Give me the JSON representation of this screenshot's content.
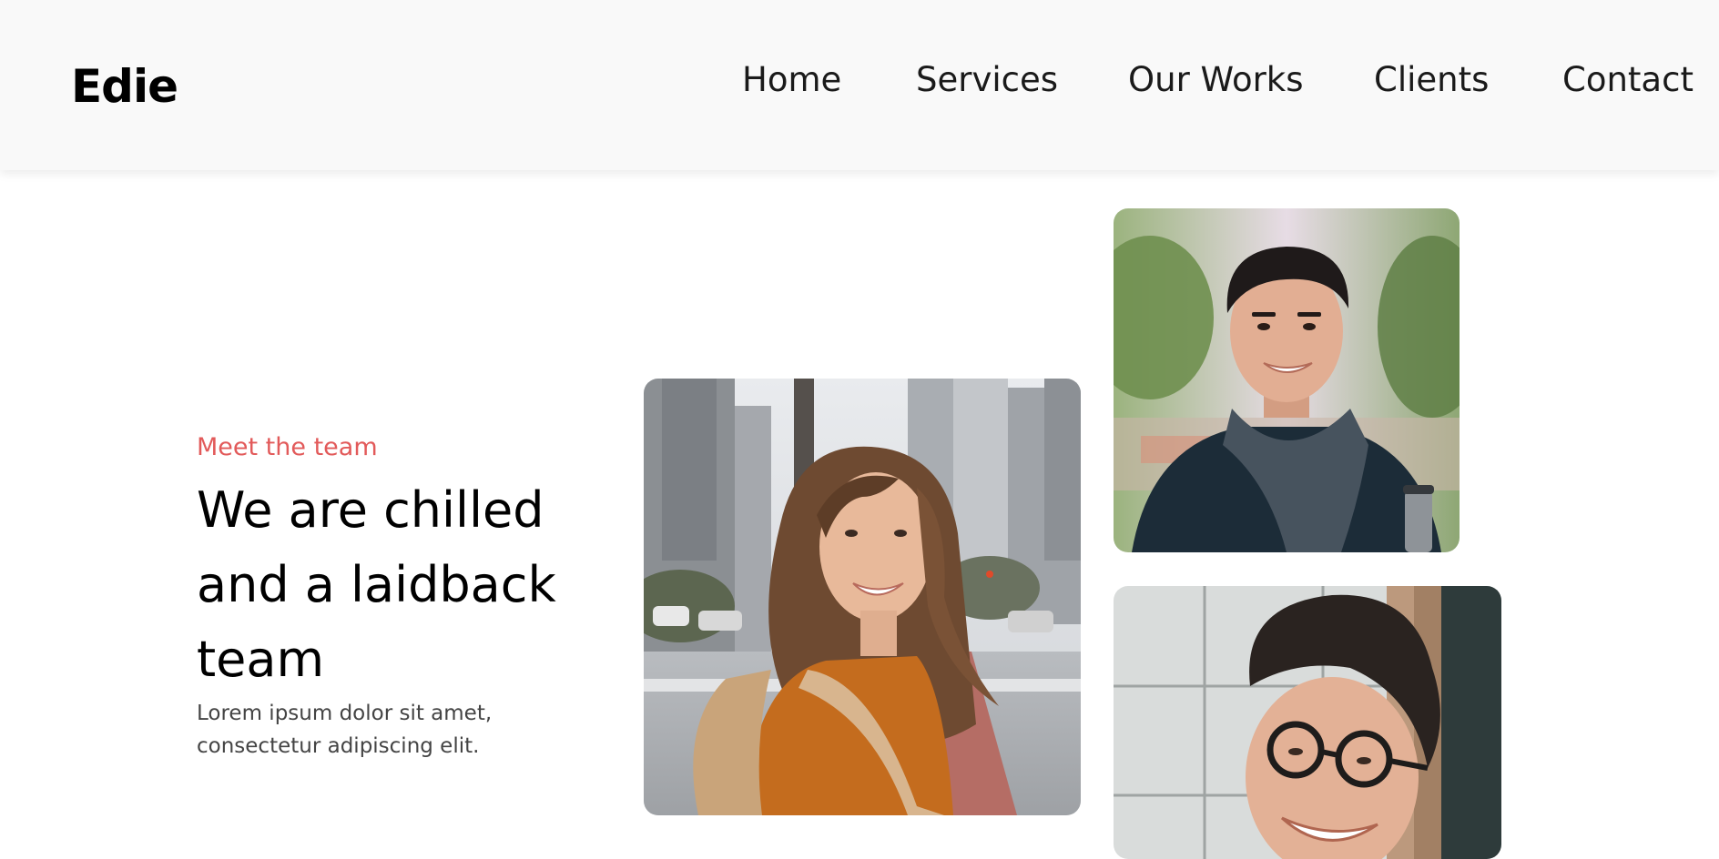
{
  "brand": {
    "name": "Edie"
  },
  "nav": {
    "items": [
      {
        "label": "Home"
      },
      {
        "label": "Services"
      },
      {
        "label": "Our Works"
      },
      {
        "label": "Clients"
      },
      {
        "label": "Contact"
      }
    ]
  },
  "hero": {
    "eyebrow": "Meet the team",
    "headline": "We are chilled and a laidback team",
    "lead": "Lorem ipsum dolor sit amet, consectetur adipiscing elit."
  },
  "colors": {
    "accent": "#e25a5a",
    "header_bg": "#f9f9f9",
    "text": "#000000"
  },
  "team_photos": [
    {
      "subject": "woman-smiling-city-street"
    },
    {
      "subject": "man-smiling-scarf"
    },
    {
      "subject": "man-smiling-glasses"
    }
  ]
}
